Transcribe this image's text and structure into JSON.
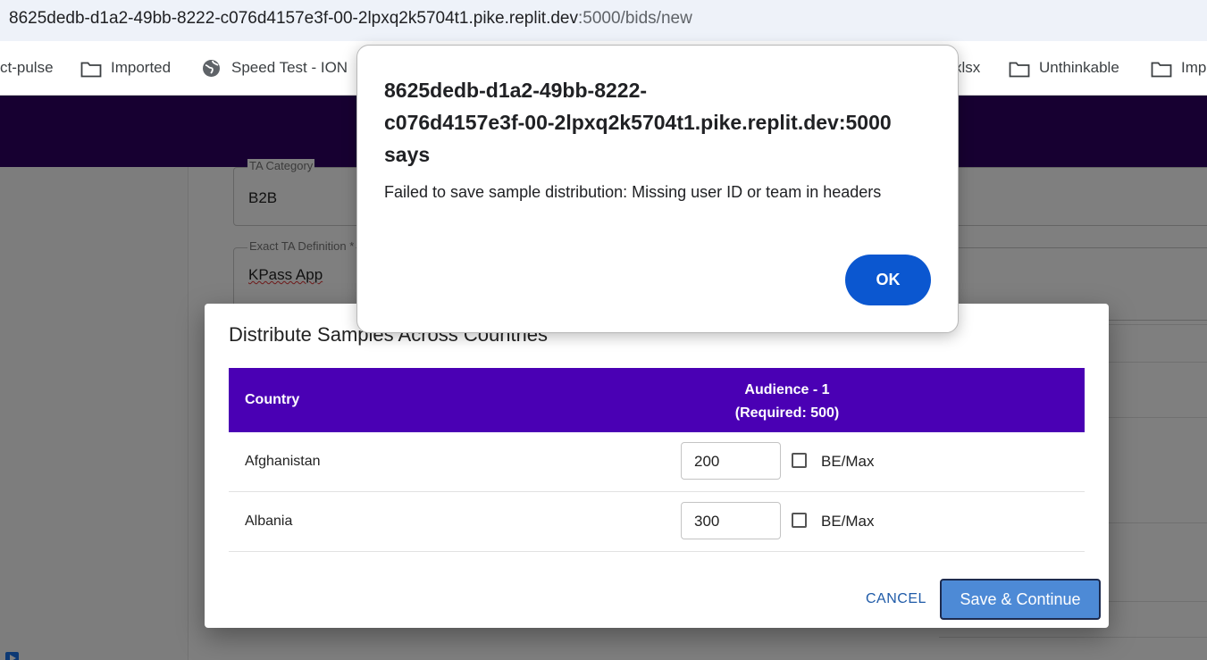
{
  "browser": {
    "url_main": "8625dedb-d1a2-49bb-8222-c076d4157e3f-00-2lpxq2k5704t1.pike.replit.dev",
    "url_rest": ":5000/bids/new"
  },
  "bookmarks": [
    {
      "label": "ct-pulse",
      "icon": "none"
    },
    {
      "label": "Imported",
      "icon": "folder-icon"
    },
    {
      "label": "Speed Test - ION",
      "icon": "globe-icon"
    },
    {
      "label": "xlsx",
      "icon": "none"
    },
    {
      "label": "Unthinkable",
      "icon": "folder-icon"
    },
    {
      "label": "Imp",
      "icon": "folder-icon"
    }
  ],
  "form": {
    "ta_category_label": "TA Category",
    "ta_category_value": "B2B",
    "exact_ta_label": "Exact TA Definition *",
    "exact_ta_value": "KPass App"
  },
  "distribute_dialog": {
    "title": "Distribute Samples Across Countries",
    "col_country": "Country",
    "col_audience": "Audience - 1",
    "col_required": "(Required: 500)",
    "rows": [
      {
        "country": "Afghanistan",
        "quantity": "200",
        "be_max_label": "BE/Max",
        "be_max_checked": false
      },
      {
        "country": "Albania",
        "quantity": "300",
        "be_max_label": "BE/Max",
        "be_max_checked": false
      }
    ],
    "cancel_label": "CANCEL",
    "save_label": "Save & Continue"
  },
  "alert": {
    "origin": "8625dedb-d1a2-49bb-8222-c076d4157e3f-00-2lpxq2k5704t1.pike.replit.dev:5000",
    "says": "says",
    "message": "Failed to save sample distribution: Missing user ID or team in headers",
    "ok_label": "OK"
  },
  "colors": {
    "header_purple": "#2e0063",
    "table_header": "#4a00b4",
    "ok_blue": "#0b57d0",
    "save_blue": "#4d8ad6"
  }
}
